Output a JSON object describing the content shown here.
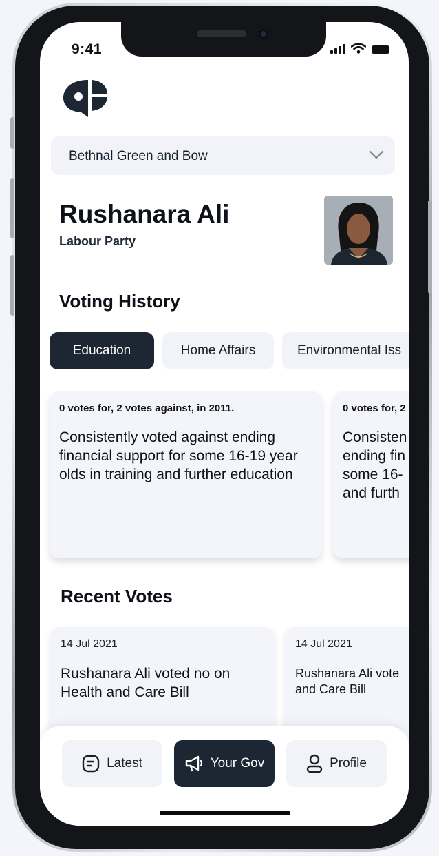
{
  "status_bar": {
    "time": "9:41"
  },
  "constituency": {
    "selected": "Bethnal Green and Bow"
  },
  "mp": {
    "name": "Rushanara Ali",
    "party": "Labour Party"
  },
  "voting_history": {
    "title": "Voting History",
    "tabs": [
      {
        "label": "Education",
        "active": true
      },
      {
        "label": "Home Affairs",
        "active": false
      },
      {
        "label": "Environmental Iss",
        "active": false
      }
    ],
    "cards": [
      {
        "meta": "0 votes for, 2 votes against, in 2011.",
        "text": "Consistently voted against ending financial support for some 16-19 year olds in training and further education"
      },
      {
        "meta": "0 votes for, 2",
        "text": "Consisten ending fin some 16- and furth"
      }
    ]
  },
  "recent_votes": {
    "title": "Recent Votes",
    "cards": [
      {
        "date": "14 Jul 2021",
        "text": "Rushanara Ali voted no on Health and Care Bill"
      },
      {
        "date": "14 Jul 2021",
        "text": "Rushanara Ali vote and Care Bill"
      }
    ]
  },
  "bottom_nav": {
    "items": [
      {
        "label": "Latest",
        "icon": "news-icon",
        "active": false
      },
      {
        "label": "Your Gov",
        "icon": "megaphone-icon",
        "active": true
      },
      {
        "label": "Profile",
        "icon": "user-icon",
        "active": false
      }
    ]
  },
  "colors": {
    "primary": "#1c2733",
    "card_bg": "#f4f5fa",
    "chip_bg": "#f2f3f9"
  }
}
